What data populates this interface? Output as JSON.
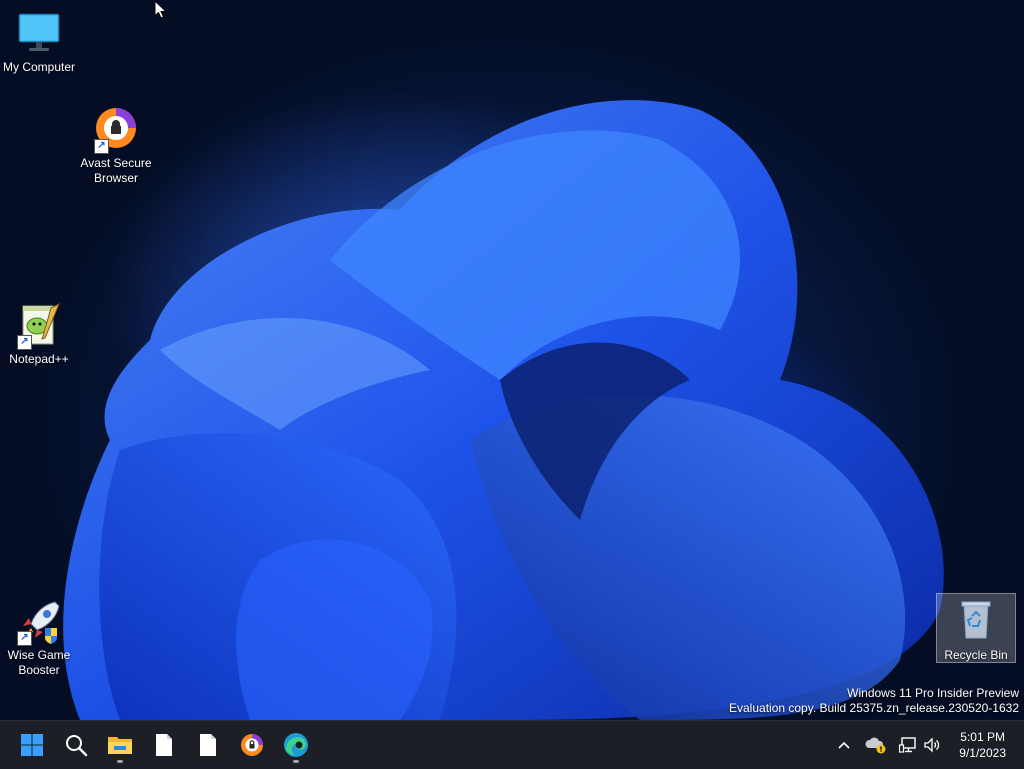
{
  "desktop": {
    "icons": [
      {
        "label": "My Computer"
      },
      {
        "label": "Avast Secure Browser"
      },
      {
        "label": "Notepad++"
      },
      {
        "label": "Wise Game Booster"
      },
      {
        "label": "Recycle Bin"
      }
    ]
  },
  "watermark": {
    "line1": "Windows 11 Pro Insider Preview",
    "line2": "Evaluation copy. Build 25375.zn_release.230520-1632"
  },
  "taskbar": {
    "pinned": [
      {
        "icon": "windows-start-icon"
      },
      {
        "icon": "search-icon"
      },
      {
        "icon": "file-explorer-icon"
      },
      {
        "icon": "document-icon"
      },
      {
        "icon": "document-icon"
      },
      {
        "icon": "avast-browser-icon"
      },
      {
        "icon": "edge-icon"
      }
    ],
    "tray": {
      "icons": [
        "chevron-up-icon",
        "onedrive-warning-icon",
        "network-icon",
        "volume-icon"
      ]
    },
    "clock": {
      "time": "5:01 PM",
      "date": "9/1/2023"
    }
  },
  "colors": {
    "taskbar_bg": "#1c1f26",
    "wallpaper_accent": "#1f5bff",
    "windows_logo": "#3aa0ff"
  }
}
